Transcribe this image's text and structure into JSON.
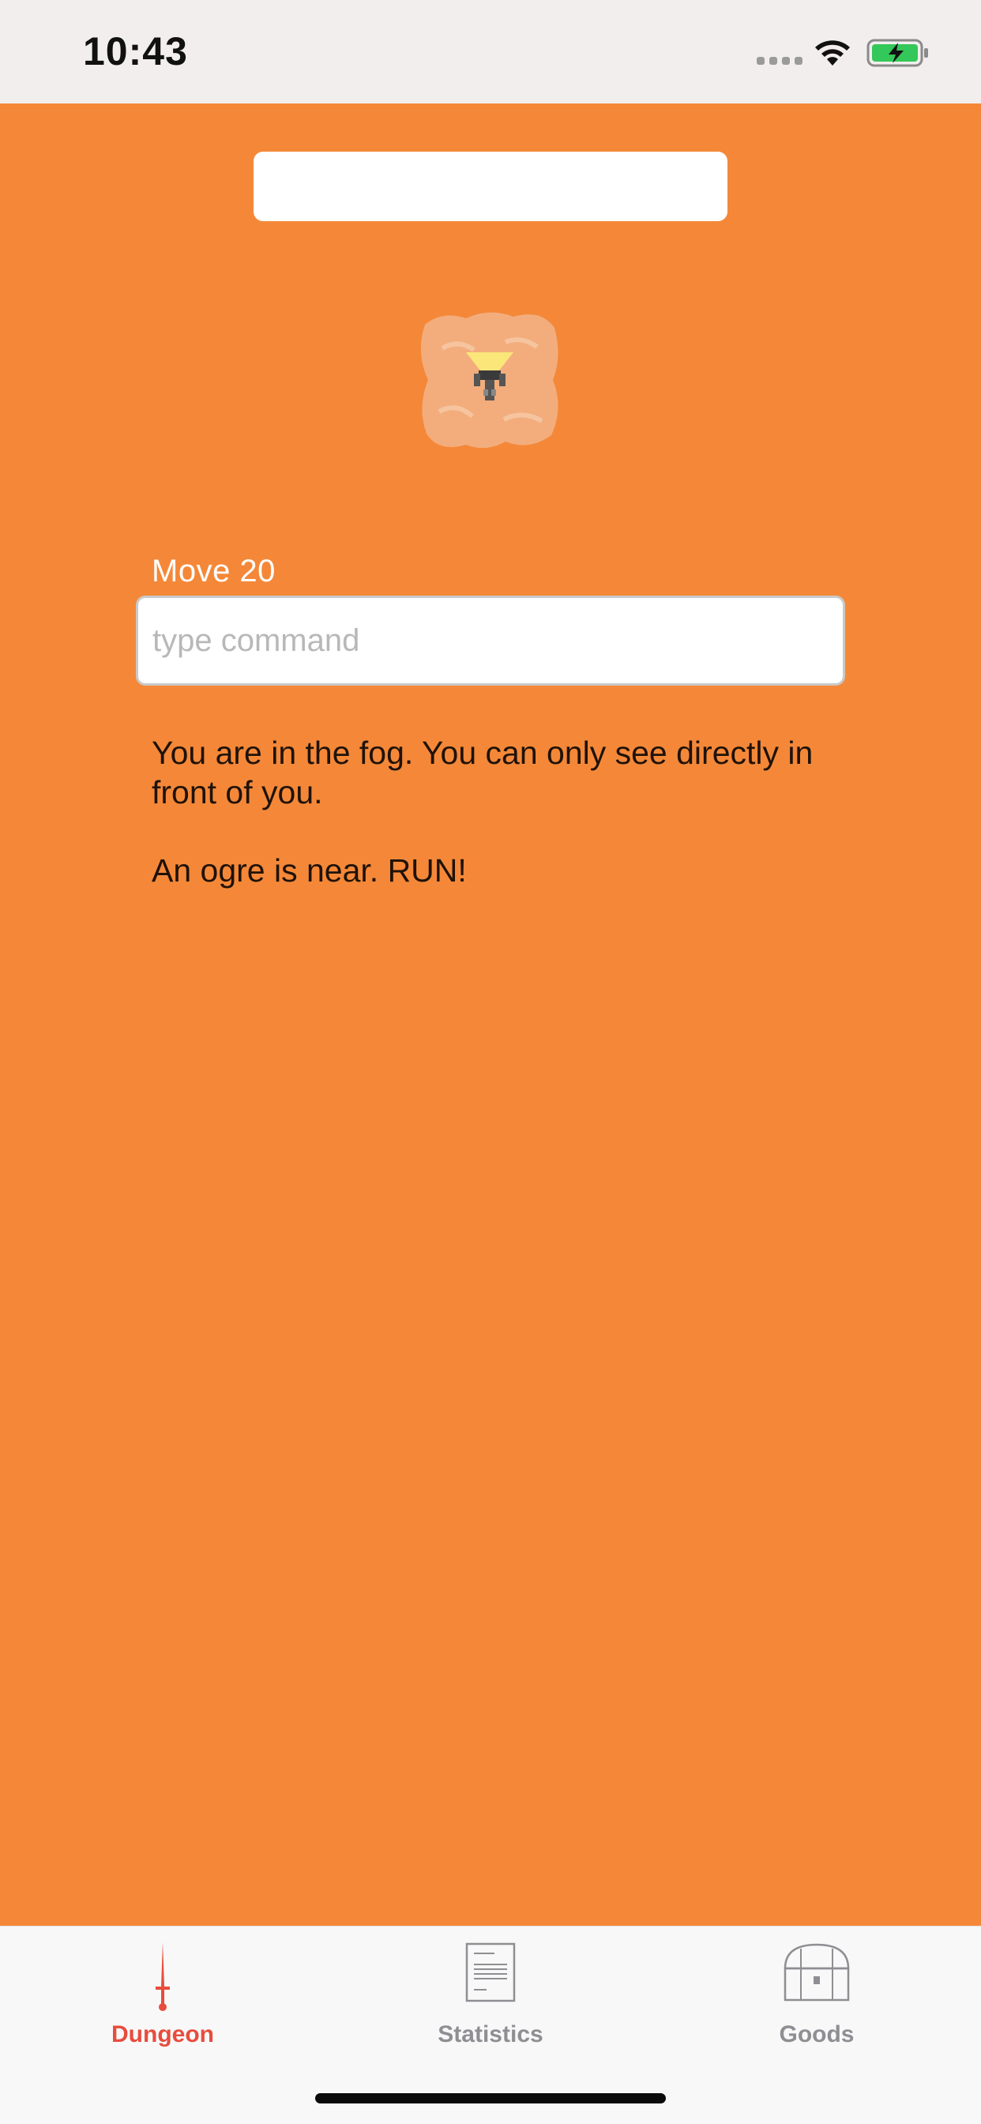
{
  "status_bar": {
    "time": "10:43"
  },
  "game": {
    "title_value": "",
    "move_label": "Move 20",
    "command_placeholder": "type command",
    "command_value": "",
    "messages": [
      "You are in the fog. You can only see directly in front of you.",
      "An ogre is near. RUN!"
    ]
  },
  "tab_bar": {
    "tabs": [
      {
        "label": "Dungeon",
        "icon": "sword-icon",
        "selected": true
      },
      {
        "label": "Statistics",
        "icon": "document-icon",
        "selected": false
      },
      {
        "label": "Goods",
        "icon": "treasure-chest-icon",
        "selected": false
      }
    ]
  },
  "colors": {
    "background": "#F48838",
    "active_tab": "#E84C3D",
    "inactive_tab": "#8E8E93",
    "status_bar_bg": "#F3EEEE"
  }
}
